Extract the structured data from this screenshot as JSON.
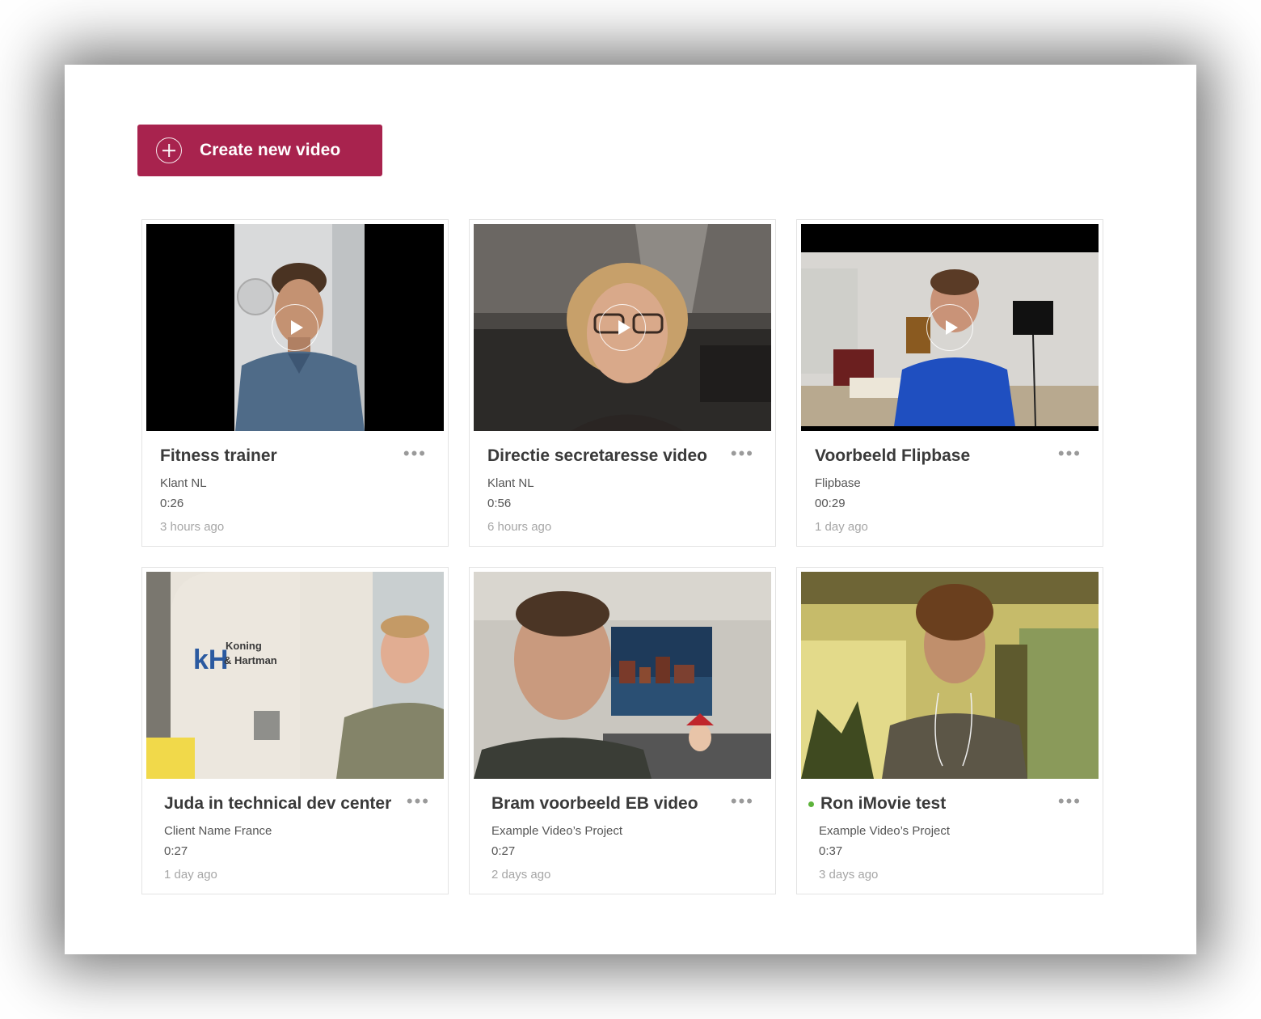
{
  "toolbar": {
    "create_label": "Create new video",
    "create_icon": "plus-circle-icon",
    "accent": "#a8234e"
  },
  "videos": [
    {
      "title": "Fitness trainer",
      "client": "Klant NL",
      "duration": "0:26",
      "age": "3 hours ago",
      "live": false,
      "show_play": true
    },
    {
      "title": "Directie secretaresse video",
      "client": "Klant NL",
      "duration": "0:56",
      "age": "6 hours ago",
      "live": false,
      "show_play": true
    },
    {
      "title": "Voorbeeld Flipbase",
      "client": "Flipbase",
      "duration": "00:29",
      "age": "1 day ago",
      "live": false,
      "show_play": true
    },
    {
      "title": "Juda in technical dev center",
      "client": "Client Name France",
      "duration": "0:27",
      "age": "1 day ago",
      "live": false,
      "show_play": false,
      "logo_text": [
        "Koning",
        "& Hartman"
      ]
    },
    {
      "title": "Bram voorbeeld EB video",
      "client": "Example Video’s Project",
      "duration": "0:27",
      "age": "2 days ago",
      "live": false,
      "show_play": false
    },
    {
      "title": "Ron iMovie test",
      "client": "Example Video’s Project",
      "duration": "0:37",
      "age": "3 days ago",
      "live": true,
      "show_play": false
    }
  ],
  "more_icon": "more-horizontal-icon",
  "status_color": "#5db33b"
}
